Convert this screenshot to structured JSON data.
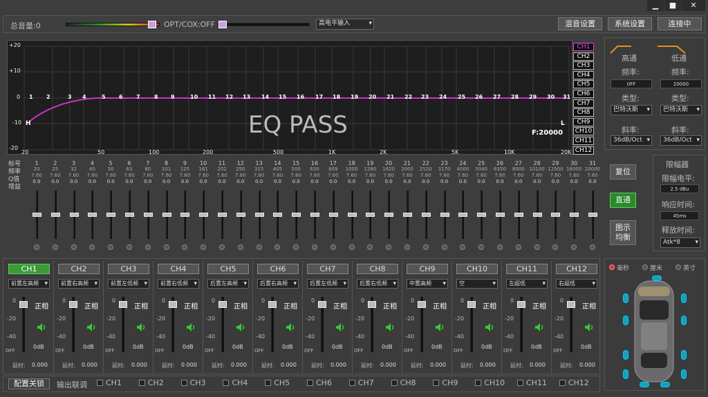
{
  "window": {
    "minimize": "▁",
    "maximize": "■",
    "close": "✕"
  },
  "topbar": {
    "total_volume": "总音量:0",
    "opt_cox": "OPT/COX:OFF",
    "input_select": "高电平输入",
    "mix_settings": "混音设置",
    "system_settings": "系统设置",
    "connect": "连接中"
  },
  "graph": {
    "label": "EQ PASS",
    "freq_label": "F:20000",
    "y_ticks": [
      "+20",
      "+10",
      "0",
      "-10",
      "-20"
    ],
    "x_ticks": [
      "20",
      "50",
      "100",
      "200",
      "500",
      "1K",
      "2K",
      "5K",
      "10K",
      "20K"
    ],
    "band_numbers": [
      "1",
      "2",
      "3",
      "4",
      "5",
      "6",
      "7",
      "8",
      "9",
      "10",
      "11",
      "12",
      "13",
      "14",
      "15",
      "16",
      "17",
      "18",
      "19",
      "20",
      "21",
      "22",
      "23",
      "24",
      "25",
      "26",
      "27",
      "28",
      "29",
      "30",
      "31"
    ],
    "h_marker": "H",
    "l_marker": "L",
    "curve_color": "#cc33cc"
  },
  "channel_buttons": [
    "CH1",
    "CH2",
    "CH3",
    "CH4",
    "CH5",
    "CH6",
    "CH7",
    "CH8",
    "CH9",
    "CH10",
    "CH11",
    "CH12"
  ],
  "eq": {
    "row_labels": [
      "标号",
      "频率",
      "Q值",
      "增益"
    ],
    "freqs": [
      "20",
      "25",
      "32",
      "40",
      "50",
      "63",
      "80",
      "101",
      "125",
      "161",
      "202",
      "250",
      "315",
      "405",
      "500",
      "630",
      "809",
      "1000",
      "1260",
      "1620",
      "2000",
      "2520",
      "3170",
      "4000",
      "5040",
      "6350",
      "8000",
      "10100",
      "12500",
      "16000",
      "20000"
    ],
    "q": "7.60",
    "gain": "0.0"
  },
  "side_buttons": {
    "reset": "复位",
    "bypass": "直通",
    "show_equalize": "图示\n均衡"
  },
  "highpass": {
    "title": "高通",
    "freq_label": "频率:",
    "freq": "0FF",
    "type_label": "类型:",
    "type": "巴特沃斯",
    "slope_label": "斜率:",
    "slope": "36dB/Oct"
  },
  "lowpass": {
    "title": "低通",
    "freq_label": "频率:",
    "freq": "20000",
    "type_label": "类型:",
    "type": "巴特沃斯",
    "slope_label": "斜率:",
    "slope": "36dB/Oct"
  },
  "limiter": {
    "title": "限幅器",
    "level_label": "限幅电平:",
    "level": "2.5 dBu",
    "attack_label": "响应时间:",
    "attack": "45ms",
    "release_label": "释放时间:",
    "release": "Atk*8"
  },
  "units": {
    "ms": "毫秒",
    "cm": "厘米",
    "inch": "英寸"
  },
  "channels": [
    {
      "name": "CH1",
      "pos": "前置左高频"
    },
    {
      "name": "CH2",
      "pos": "前置右高频"
    },
    {
      "name": "CH3",
      "pos": "前置左低频"
    },
    {
      "name": "CH4",
      "pos": "前置右低频"
    },
    {
      "name": "CH5",
      "pos": "后置左高频"
    },
    {
      "name": "CH6",
      "pos": "后置右高频"
    },
    {
      "name": "CH7",
      "pos": "后置左低频"
    },
    {
      "name": "CH8",
      "pos": "后置右低频"
    },
    {
      "name": "CH9",
      "pos": "中置高频"
    },
    {
      "name": "CH10",
      "pos": "空"
    },
    {
      "name": "CH11",
      "pos": "左超低"
    },
    {
      "name": "CH12",
      "pos": "右超低"
    }
  ],
  "channel_common": {
    "phase": "正相",
    "scale": [
      "0",
      "-20",
      "-40",
      "OFF"
    ],
    "db": "0dB",
    "delay_label": "延时:",
    "delay": "0.000"
  },
  "bottom": {
    "config_link": "配置关锁",
    "output_link": "输出联调"
  },
  "accent": "#3a9a35"
}
